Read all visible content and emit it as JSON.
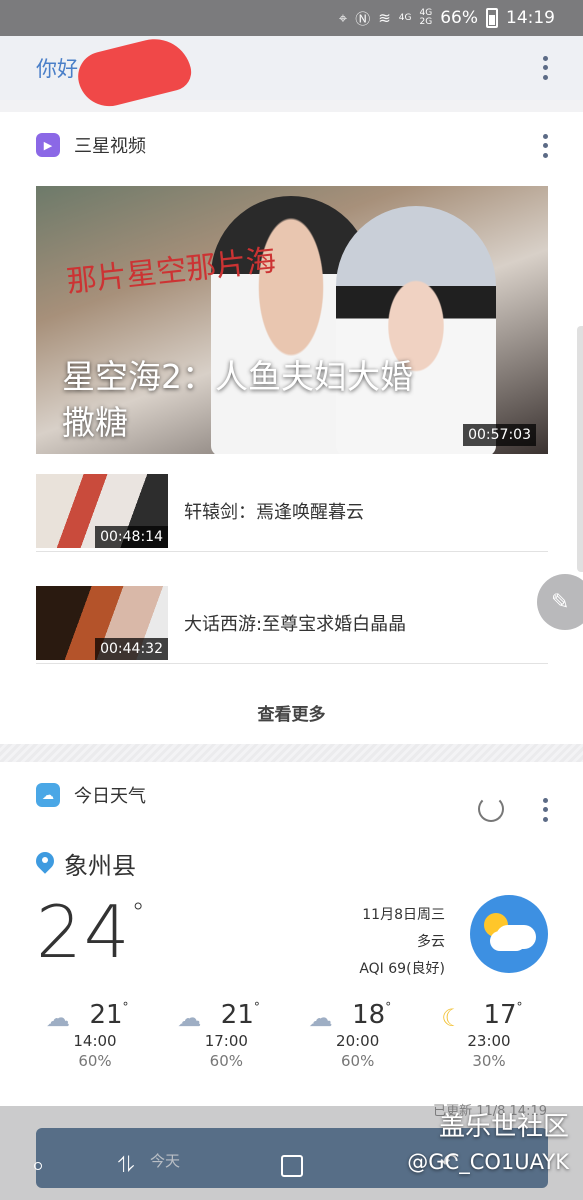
{
  "status_bar": {
    "battery": "66%",
    "time": "14:19",
    "net_top": "4G",
    "net_bottom": "4G",
    "net_bottom2": "2G"
  },
  "greeting": {
    "text": "你好"
  },
  "video_card": {
    "app_name": "三星视频",
    "hero": {
      "calligraphy": "那片星空那片海",
      "title": "星空海2：人鱼夫妇大婚撒糖",
      "duration": "00:57:03"
    },
    "items": [
      {
        "title": "轩辕剑：焉逢唤醒暮云",
        "duration": "00:48:14"
      },
      {
        "title": "大话西游:至尊宝求婚白晶晶",
        "duration": "00:44:32"
      }
    ],
    "more_label": "查看更多"
  },
  "weather_card": {
    "app_name": "今日天气",
    "location": "象州县",
    "temperature": "24",
    "degree_symbol": "°",
    "date": "11月8日周三",
    "condition": "多云",
    "aqi": "AQI 69(良好)",
    "forecast": [
      {
        "temp": "21",
        "time": "14:00",
        "precip": "60%",
        "icon": "rain-cloud-icon"
      },
      {
        "temp": "21",
        "time": "17:00",
        "precip": "60%",
        "icon": "rain-cloud-icon"
      },
      {
        "temp": "18",
        "time": "20:00",
        "precip": "60%",
        "icon": "rain-cloud-icon"
      },
      {
        "temp": "17",
        "time": "23:00",
        "precip": "30%",
        "icon": "moon-cloud-icon"
      }
    ],
    "updated": "已更新 11/8 14:19"
  },
  "bottom": {
    "today_label": "今天",
    "watermark_line1": "盖乐世社区",
    "watermark_line2": "@GC_CO1UAYK"
  },
  "colors": {
    "accent": "#4a7fc8",
    "video_icon": "#8b68e6",
    "weather_icon": "#4aa7e6",
    "status_bar": "#7b7b7d"
  }
}
